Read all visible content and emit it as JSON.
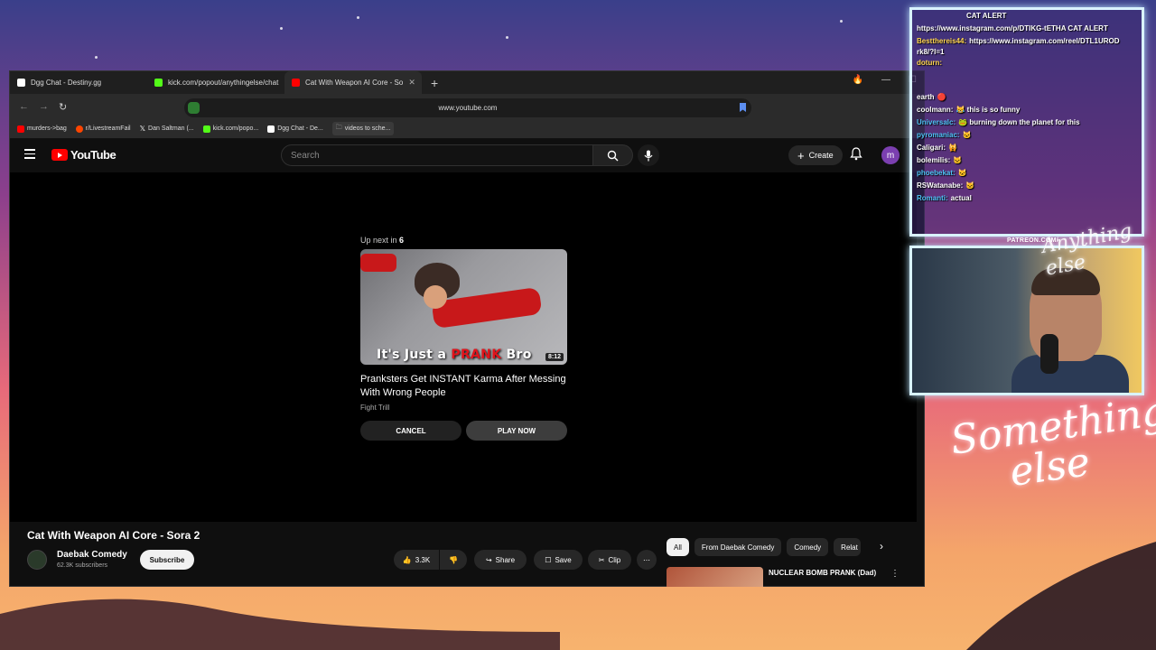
{
  "browser": {
    "tabs": [
      {
        "label": "Dgg Chat - Destiny.gg",
        "color": "#ffffff",
        "active": false
      },
      {
        "label": "kick.com/popout/anythingelse/chat",
        "color": "#53fc18",
        "active": false
      },
      {
        "label": "Cat With Weapon AI Core - So",
        "color": "#ff0000",
        "active": true
      }
    ],
    "new_tab": "+",
    "url": "www.youtube.com",
    "bookmarks": [
      {
        "label": "murders->bag",
        "color": "#ff0000"
      },
      {
        "label": "r/LivestreamFail",
        "color": "#ff4500"
      },
      {
        "label": "Dan Saltman (...",
        "color": "#ffffff"
      },
      {
        "label": "kick.com/popo...",
        "color": "#53fc18"
      },
      {
        "label": "Dgg Chat - De...",
        "color": "#ffffff"
      },
      {
        "label": "videos to sche...",
        "color": "#aaaaaa"
      }
    ]
  },
  "youtube": {
    "logo": "YouTube",
    "search_placeholder": "Search",
    "create_label": "Create",
    "avatar_letter": "m"
  },
  "player": {
    "up_next_prefix": "Up next in",
    "countdown": "6",
    "thumb_caption_pre": "It's Just a",
    "thumb_caption_red": "PRANK",
    "thumb_caption_post": "Bro",
    "duration": "8:12",
    "next_title": "Pranksters Get INSTANT Karma After Messing With Wrong People",
    "next_channel": "Fight Trill",
    "cancel_label": "CANCEL",
    "play_label": "PLAY NOW"
  },
  "video": {
    "title": "Cat With Weapon AI Core - Sora 2",
    "channel": "Daebak Comedy",
    "subscribers": "62.3K subscribers",
    "subscribe_label": "Subscribe",
    "likes": "3.3K",
    "share_label": "Share",
    "save_label": "Save",
    "clip_label": "Clip"
  },
  "chips": [
    "All",
    "From Daebak Comedy",
    "Comedy",
    "Relat"
  ],
  "recommended": {
    "title": "NUCLEAR BOMB PRANK (Dad)"
  },
  "chat": {
    "lines": [
      {
        "user": "",
        "color": "#ff4d4d",
        "text": "CAT ALERT"
      },
      {
        "user": "",
        "color": "#ffffff",
        "text": "https://www.instagram.com/p/DTIKG-tETHA CAT ALERT"
      },
      {
        "user": "Bestthereis44:",
        "color": "#ffd54f",
        "text": "https://www.instagram.com/reel/DTL1UROD rk8/?l=1"
      },
      {
        "user": "doturn:",
        "color": "#ffd54f",
        "text": ""
      },
      {
        "user": "earth",
        "color": "#ffffff",
        "text": ""
      },
      {
        "user": "coolmann:",
        "color": "#ffffff",
        "text": "this is so funny"
      },
      {
        "user": "Universalc:",
        "color": "#4fc3f7",
        "text": "burning down the planet for this"
      },
      {
        "user": "pyromaniac:",
        "color": "#4fc3f7",
        "text": ""
      },
      {
        "user": "Caligari:",
        "color": "#ffffff",
        "text": ""
      },
      {
        "user": "bolemilis:",
        "color": "#ffffff",
        "text": ""
      },
      {
        "user": "phoebekat:",
        "color": "#4fc3f7",
        "text": ""
      },
      {
        "user": "RSWatanabe:",
        "color": "#ffffff",
        "text": ""
      },
      {
        "user": "Romanti:",
        "color": "#4fc3f7",
        "text": "actual"
      }
    ]
  },
  "overlay": {
    "patreon": "PATREON.COM/",
    "brand_small": "Anything else",
    "brand_line1": "Something",
    "brand_line2": "else"
  }
}
